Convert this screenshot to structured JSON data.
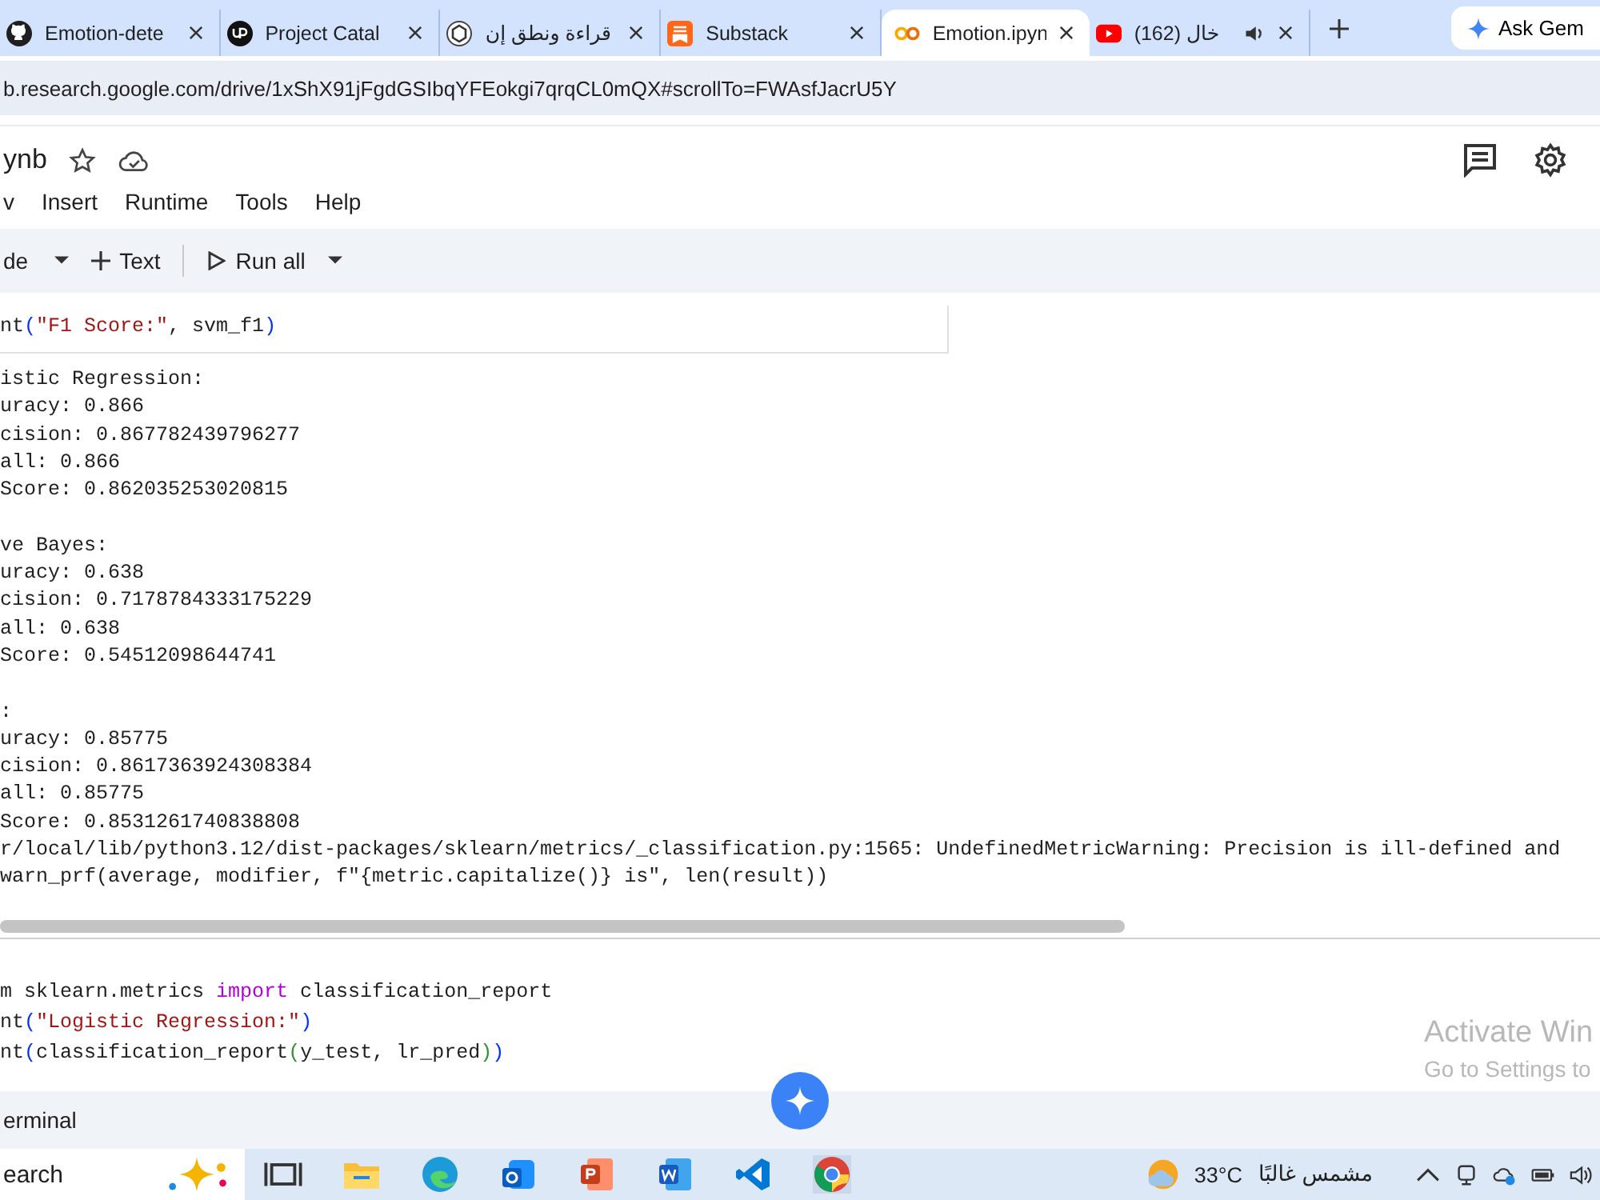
{
  "browser": {
    "tabs": [
      {
        "title": "Emotion-dete",
        "selected": false
      },
      {
        "title": "Project Catal",
        "selected": false
      },
      {
        "title": "قراءة ونطق إن",
        "selected": false
      },
      {
        "title": "Substack",
        "selected": false
      },
      {
        "title": "Emotion.ipyn",
        "selected": true
      },
      {
        "title": "(162) خال",
        "selected": false,
        "audio": true
      }
    ],
    "ask_button": "Ask Gem",
    "url": "b.research.google.com/drive/1xShX91jFgdGSIbqYFEokgi7qrqCL0mQX#scrollTo=FWAsfJacrU5Y"
  },
  "notebook": {
    "title": "ynb",
    "menu": [
      "v",
      "Insert",
      "Runtime",
      "Tools",
      "Help"
    ],
    "toolbar": [
      {
        "kind": "dropdown",
        "label": "de"
      },
      {
        "kind": "add",
        "label": "Text"
      },
      {
        "kind": "run",
        "label": "Run all"
      }
    ]
  },
  "cells": [
    {
      "code": [
        [
          {
            "t": "nt",
            "kind": "plain"
          },
          {
            "t": "(",
            "kind": "paren"
          },
          {
            "t": "\"F1 Score:\"",
            "kind": "string"
          },
          {
            "t": ", svm_f1",
            "kind": "plain"
          },
          {
            "t": ")",
            "kind": "paren"
          }
        ]
      ],
      "output": [
        [
          "istic Regression:",
          "uracy: 0.866",
          "cision: 0.867782439796277",
          "all: 0.866",
          "Score: 0.862035253020815"
        ],
        [
          "ve Bayes:",
          "uracy: 0.638",
          "cision: 0.7178784333175229",
          "all: 0.638",
          "Score: 0.54512098644741"
        ],
        [
          ":",
          "uracy: 0.85775",
          "cision: 0.8617363924308384",
          "all: 0.85775",
          "Score: 0.8531261740838808",
          "r/local/lib/python3.12/dist-packages/sklearn/metrics/_classification.py:1565: UndefinedMetricWarning: Precision is ill-defined and",
          "warn_prf(average, modifier, f\"{metric.capitalize()} is\", len(result))"
        ]
      ]
    },
    {
      "code": [
        [
          {
            "t": "m sklearn.metrics ",
            "kind": "plain"
          },
          {
            "t": "import",
            "kind": "keyword"
          },
          {
            "t": " classification_report",
            "kind": "plain"
          }
        ],
        [
          {
            "t": "nt",
            "kind": "plain"
          },
          {
            "t": "(",
            "kind": "paren"
          },
          {
            "t": "\"Logistic Regression:\"",
            "kind": "string"
          },
          {
            "t": ")",
            "kind": "paren"
          }
        ],
        [
          {
            "t": "nt",
            "kind": "plain"
          },
          {
            "t": "(",
            "kind": "paren"
          },
          {
            "t": "classification_report",
            "kind": "plain"
          },
          {
            "t": "(",
            "kind": "paren2"
          },
          {
            "t": "y_test, lr_pred",
            "kind": "plain"
          },
          {
            "t": ")",
            "kind": "paren2"
          },
          {
            "t": ")",
            "kind": "paren"
          }
        ]
      ]
    }
  ],
  "terminal": "erminal",
  "activation": {
    "title": "Activate Win",
    "subtitle": "Go to Settings to"
  },
  "taskbar": {
    "search": "earch",
    "weather": "33°C",
    "forecast": "مشمس غالبًا"
  }
}
